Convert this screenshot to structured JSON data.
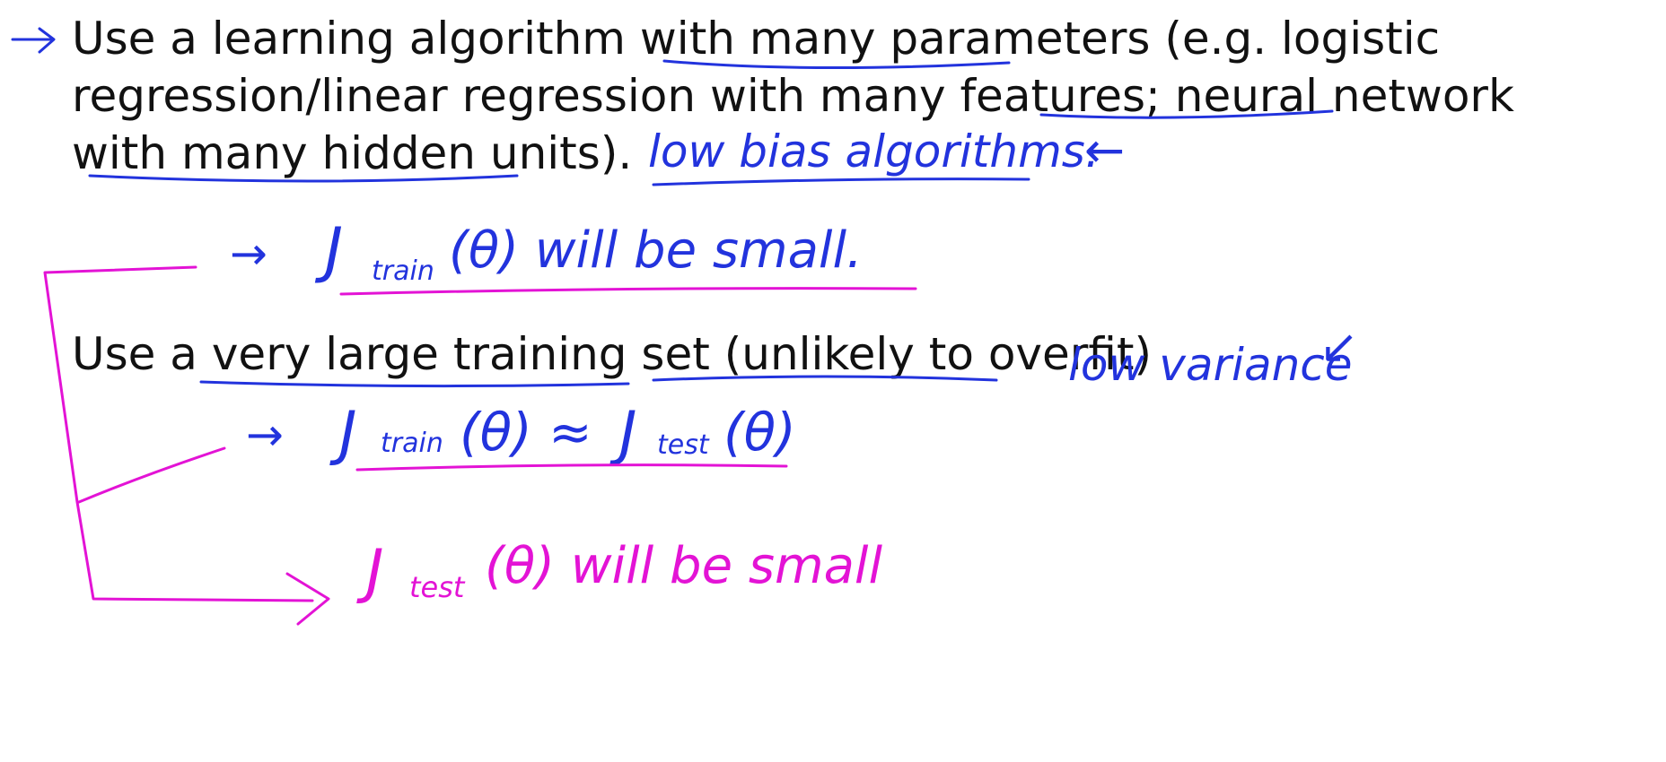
{
  "colors": {
    "background": "#ffffff",
    "text": "#111111",
    "ink_blue": "#2233dd",
    "ink_pink": "#e313d5"
  },
  "bullet1": {
    "line1_pre": "Use a learning algorithm with ",
    "line1_u1": "many parameters",
    "line1_post": " (e.g. logistic",
    "line2_pre": "regression/linear regression with many features; ",
    "line2_u1": "neural network",
    "line3_u1": "with many hidden units",
    "line3_post": ")."
  },
  "bullet2": {
    "pre": "Use a ",
    "u1": "very large training set",
    "mid": " (",
    "u2": "unlikely to overfit",
    "post": ")"
  },
  "annotations": {
    "low_bias": "low bias algorithms.",
    "low_variance": "low variance",
    "arrow_left": "←",
    "arrow_down_left": "↙",
    "train_small_arrow": "→",
    "train_small_J": "J",
    "train_small_sub": "train",
    "train_small_rest": "(θ) will be small.",
    "approx_arrow": "→",
    "approx_J1": "J",
    "approx_sub1": "train",
    "approx_mid": "(θ) ≈",
    "approx_J2": "J",
    "approx_sub2": "test",
    "approx_end": "(θ)",
    "test_small_J": "J",
    "test_small_sub": "test",
    "test_small_rest": "(θ) will be small"
  }
}
